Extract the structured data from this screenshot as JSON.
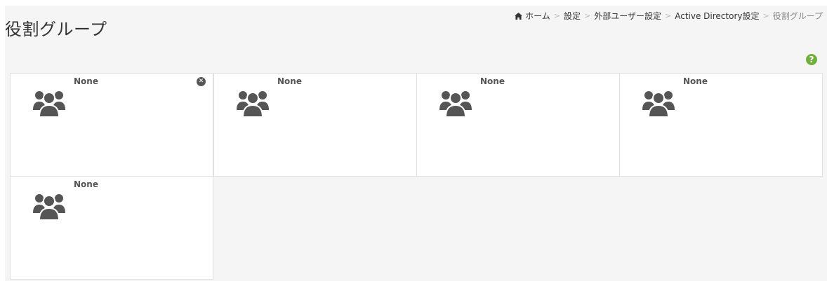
{
  "page_title": "役割グループ",
  "breadcrumb": {
    "home": "ホーム",
    "settings": "設定",
    "external_user_settings": "外部ユーザー設定",
    "active_directory_settings": "Active Directory設定",
    "current": "役割グループ",
    "separator": ">"
  },
  "help_icon": "?",
  "cards": [
    {
      "label": "None",
      "icon": "user-group-icon",
      "removable": true
    },
    {
      "label": "None",
      "icon": "user-group-icon",
      "removable": false
    },
    {
      "label": "None",
      "icon": "user-group-icon",
      "removable": false
    },
    {
      "label": "None",
      "icon": "user-group-icon",
      "removable": false
    },
    {
      "label": "None",
      "icon": "user-group-icon",
      "removable": false
    }
  ],
  "remove_glyph": "✕",
  "colors": {
    "help": "#6fb03a",
    "icon": "#555555",
    "background": "#f5f5f5"
  }
}
